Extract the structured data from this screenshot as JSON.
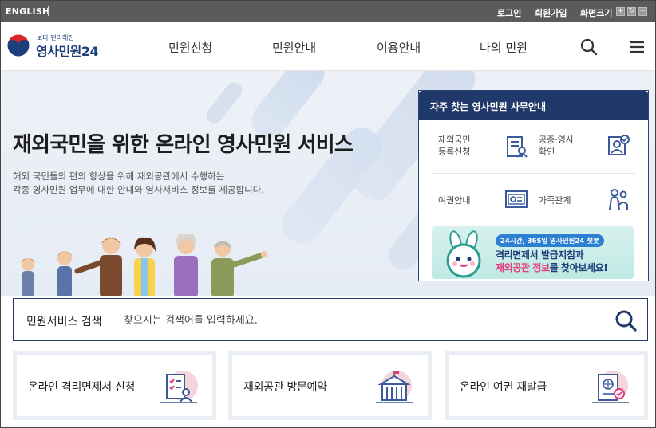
{
  "topbar": {
    "english": "ENGLISH",
    "login": "로그인",
    "signup": "회원가입",
    "screen_size": "화면크기",
    "zoom_in": "+",
    "zoom_reset": "↻",
    "zoom_out": "−"
  },
  "header": {
    "logo_sub": "보다 편리해진",
    "logo_main": "영사민원24",
    "nav": [
      "민원신청",
      "민원안내",
      "이용안내",
      "나의 민원"
    ]
  },
  "hero": {
    "title": "재외국민을 위한 온라인 영사민원 서비스",
    "desc_line1": "해외 국민들의 편의 향상을 위해 재외공관에서 수행하는",
    "desc_line2": "각종 영사민원 업무에 대한 안내와 영사서비스 정보를 제공합니다."
  },
  "panel": {
    "title": "자주 찾는 영사민원 사무안내",
    "items": [
      {
        "line1": "재외국민",
        "line2": "등록신청",
        "icon": "registration-icon"
      },
      {
        "line1": "공증·영사",
        "line2": "확인",
        "icon": "notarization-icon"
      },
      {
        "line1": "여권안내",
        "line2": "",
        "icon": "passport-icon"
      },
      {
        "line1": "가족관계",
        "line2": "",
        "icon": "family-icon"
      }
    ],
    "banner": {
      "top": "24시간, 365일 영사민원24 챗봇",
      "line1": "격리면제서 발급지침과",
      "line2_accent": "재외공관 정보",
      "line2_rest": "를 찾아보세요!"
    }
  },
  "search": {
    "label": "민원서비스 검색",
    "placeholder": "찾으시는 검색어를 입력하세요."
  },
  "cards": [
    {
      "label": "온라인 격리면제서 신청",
      "icon": "quarantine-form-icon"
    },
    {
      "label": "재외공관 방문예약",
      "icon": "embassy-building-icon"
    },
    {
      "label": "온라인 여권 재발급",
      "icon": "passport-reissue-icon"
    }
  ],
  "colors": {
    "navy": "#20386a",
    "topbar": "#5b5b5b",
    "hero_bg": "#e9eef5",
    "accent_pink": "#e23a7a"
  }
}
